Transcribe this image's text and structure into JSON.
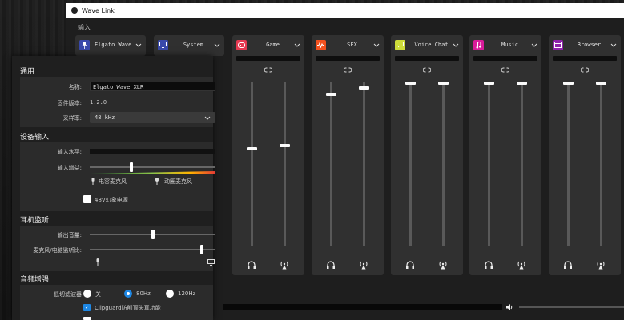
{
  "window": {
    "title": "Wave Link"
  },
  "section_input_label": "输入",
  "channels_top": [
    {
      "name": "Elgato Wave XLR",
      "icon": "mic-icon",
      "color": "#3949ab"
    },
    {
      "name": "System",
      "icon": "monitor-icon",
      "color": "#3949ab"
    }
  ],
  "channels": [
    {
      "name": "Game",
      "icon": "gamepad-icon",
      "color": "#e53951",
      "left_level": 0.6,
      "right_level": 0.62
    },
    {
      "name": "SFX",
      "icon": "waveform-icon",
      "color": "#f4511e",
      "left_level": 0.93,
      "right_level": 0.97
    },
    {
      "name": "Voice Chat",
      "icon": "chat-icon",
      "color": "#cddc39",
      "left_level": 1.0,
      "right_level": 1.0
    },
    {
      "name": "Music",
      "icon": "music-note-icon",
      "color": "#d81b9a",
      "left_level": 1.0,
      "right_level": 1.0
    },
    {
      "name": "Browser",
      "icon": "browser-icon",
      "color": "#8e24aa",
      "left_level": 1.0,
      "right_level": 1.0
    }
  ],
  "panel": {
    "general_title": "通用",
    "name_label": "名称:",
    "name_value": "Elgato Wave XLR",
    "fw_label": "固件版本:",
    "fw_value": "1.2.0",
    "rate_label": "采样率:",
    "rate_value": "48 kHz",
    "device_input_title": "设备输入",
    "input_level_label": "输入水平:",
    "input_gain_label": "输入增益:",
    "input_gain_value": 0.33,
    "condenser_label": "电容麦克风",
    "dynamic_label": "动圈麦克风",
    "phantom_label": "48V幻象电源",
    "monitor_title": "耳机监听",
    "output_volume_label": "输出音量:",
    "output_volume_value": 0.5,
    "mix_label": "麦克风/电脑监听比:",
    "mix_value": 0.9,
    "enhance_title": "音频增强",
    "lowcut_label": "低切滤波器",
    "lowcut_off": "关",
    "lowcut_80": "80Hz",
    "lowcut_120": "120Hz",
    "clipguard_label": "Clipguard防削顶失真功能"
  },
  "bottom": {
    "output_level": 0.7
  }
}
